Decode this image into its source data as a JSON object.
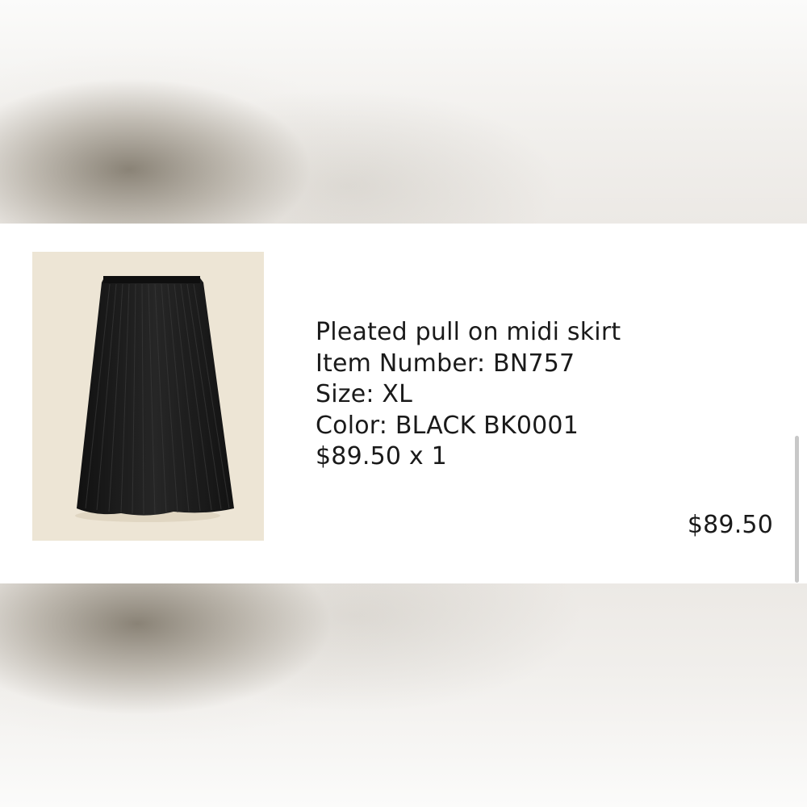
{
  "order_item": {
    "image_icon": "pleated-skirt-product-image",
    "name": "Pleated pull on midi skirt",
    "item_number": "Item Number: BN757",
    "size": "Size: XL",
    "color": "Color: BLACK BK0001",
    "price_qty": "$89.50 x 1",
    "line_total": "$89.50"
  },
  "colors": {
    "image_background": "#ede5d5",
    "skirt": "#1c1c1c",
    "text": "#1a1a1a"
  }
}
